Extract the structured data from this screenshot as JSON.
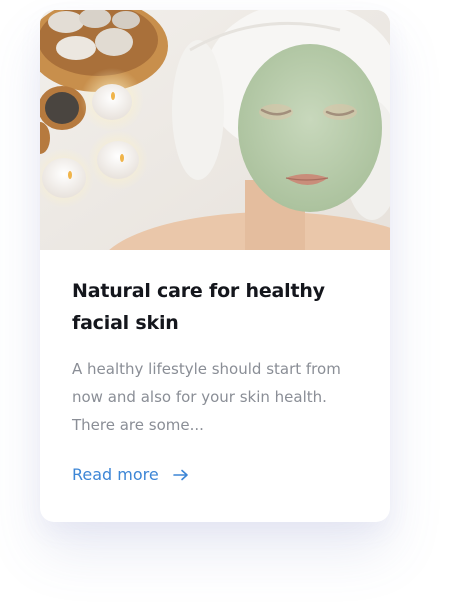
{
  "card": {
    "image_description_icon": "spa-facial-mask-photo",
    "title": "Natural care for healthy facial skin",
    "excerpt": "A healthy lifestyle should start from now and also for your skin health. There are some...",
    "link_label": "Read more",
    "link_icon": "arrow-right-icon"
  },
  "colors": {
    "title": "#14161c",
    "excerpt": "#8a8e96",
    "link": "#3d86d6",
    "card_background": "#ffffff"
  }
}
